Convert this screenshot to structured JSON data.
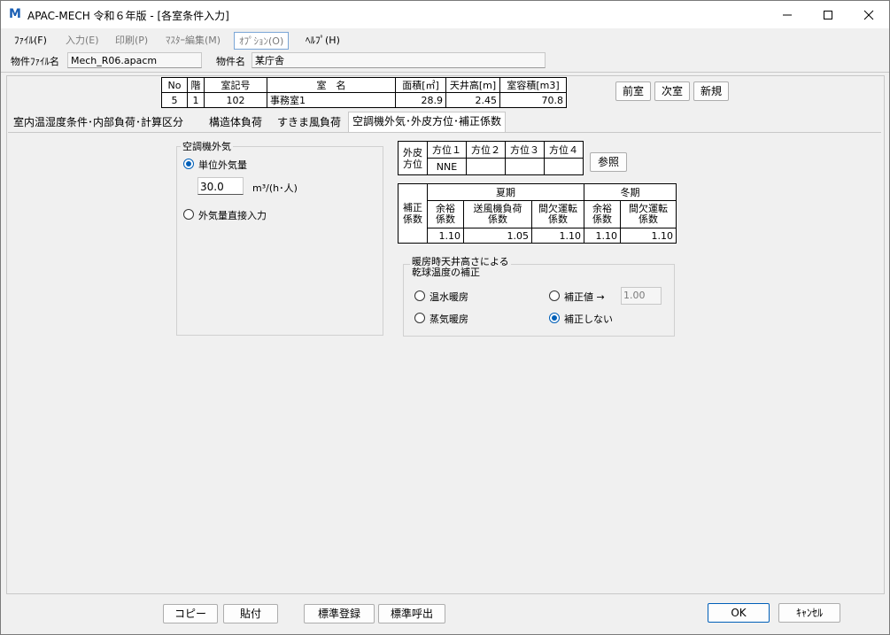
{
  "titlebar": {
    "icon_glyph": "M",
    "title": "APAC-MECH 令和６年版 - [各室条件入力]"
  },
  "menu": [
    {
      "label": "ﾌｧｲﾙ(F)"
    },
    {
      "label": "入力(E)"
    },
    {
      "label": "印刷(P)"
    },
    {
      "label": "ﾏｽﾀｰ編集(M)"
    },
    {
      "label": "ｵﾌﾟｼｮﾝ(O)"
    },
    {
      "label": "ﾍﾙﾌﾟ(H)"
    }
  ],
  "info": {
    "file_label": "物件ﾌｧｲﾙ名",
    "file_value": "Mech_R06.apacm",
    "name_label": "物件名",
    "name_value": "某庁舎"
  },
  "room_table": {
    "headers": [
      "No",
      "階",
      "室記号",
      "室　名",
      "面積[㎡]",
      "天井高[m]",
      "室容積[m3]"
    ],
    "row": [
      "5",
      "1",
      "102",
      "事務室1",
      "28.9",
      "2.45",
      "70.8"
    ]
  },
  "nav_buttons": {
    "prev": "前室",
    "next": "次室",
    "new": "新規"
  },
  "tabs": [
    "室内温湿度条件･内部負荷･計算区分",
    "構造体負荷",
    "すきま風負荷",
    "空調機外気･外皮方位･補正係数"
  ],
  "outdoor_air": {
    "group_label": "空調機外気",
    "opt1": "単位外気量",
    "value": "30.0",
    "unit": "m³/(h･人)",
    "opt2": "外気量直接入力"
  },
  "orientation": {
    "side_label": "外皮\n方位",
    "headers": [
      "方位１",
      "方位２",
      "方位３",
      "方位４"
    ],
    "values": [
      "NNE",
      "",
      "",
      ""
    ],
    "ref_button": "参照"
  },
  "coef": {
    "side_label": "補正\n係数",
    "summer": "夏期",
    "winter": "冬期",
    "headers": [
      "余裕\n係数",
      "送風機負荷\n係数",
      "間欠運転\n係数",
      "余裕\n係数",
      "間欠運転\n係数"
    ],
    "values": [
      "1.10",
      "1.05",
      "1.10",
      "1.10",
      "1.10"
    ]
  },
  "heating": {
    "group_label": "暖房時天井高さによる\n乾球温度の補正",
    "hot_water": "温水暖房",
    "steam": "蒸気暖房",
    "corr_value_label": "補正値 →",
    "corr_value": "1.00",
    "no_corr": "補正しない"
  },
  "bottom_buttons": {
    "copy": "コピー",
    "paste": "貼付",
    "std_reg": "標準登録",
    "std_call": "標準呼出",
    "ok": "OK",
    "cancel": "ｷｬﾝｾﾙ"
  }
}
